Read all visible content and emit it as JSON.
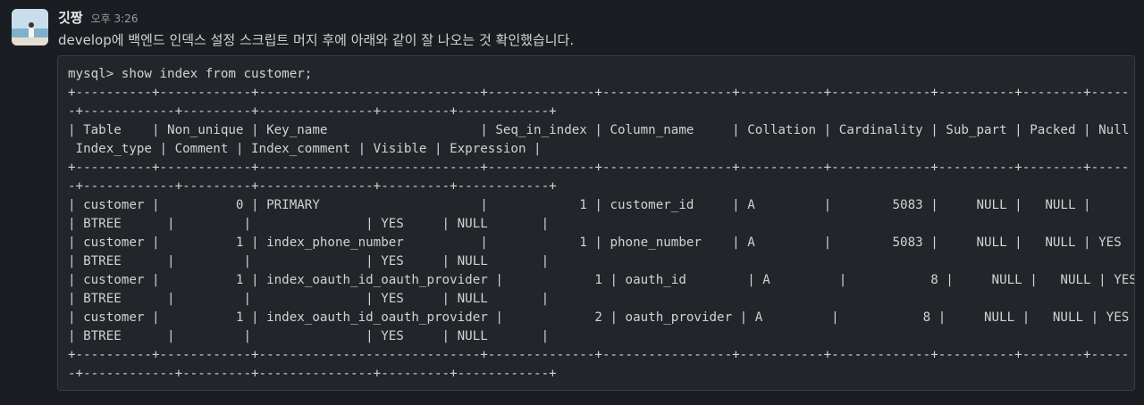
{
  "message": {
    "sender": "깃짱",
    "timestamp": "오후 3:26",
    "text": "develop에 백엔드 인덱스 설정 스크립트 머지 후에 아래와 같이 잘 나오는 것 확인했습니다.",
    "code_lines": [
      "mysql> show index from customer;",
      "+----------+------------+-----------------------------+--------------+-----------------+-----------+-------------+----------+--------+-----",
      "-+------------+---------+---------------+---------+------------+",
      "| Table    | Non_unique | Key_name                    | Seq_in_index | Column_name     | Collation | Cardinality | Sub_part | Packed | Null",
      " Index_type | Comment | Index_comment | Visible | Expression |",
      "+----------+------------+-----------------------------+--------------+-----------------+-----------+-------------+----------+--------+-----",
      "-+------------+---------+---------------+---------+------------+",
      "| customer |          0 | PRIMARY                     |            1 | customer_id     | A         |        5083 |     NULL |   NULL |",
      "| BTREE      |         |               | YES     | NULL       |",
      "| customer |          1 | index_phone_number          |            1 | phone_number    | A         |        5083 |     NULL |   NULL | YES",
      "| BTREE      |         |               | YES     | NULL       |",
      "| customer |          1 | index_oauth_id_oauth_provider |            1 | oauth_id        | A         |           8 |     NULL |   NULL | YES",
      "| BTREE      |         |               | YES     | NULL       |",
      "| customer |          1 | index_oauth_id_oauth_provider |            2 | oauth_provider | A         |           8 |     NULL |   NULL | YES",
      "| BTREE      |         |               | YES     | NULL       |",
      "+----------+------------+-----------------------------+--------------+-----------------+-----------+-------------+----------+--------+-----",
      "-+------------+---------+---------------+---------+------------+"
    ]
  }
}
